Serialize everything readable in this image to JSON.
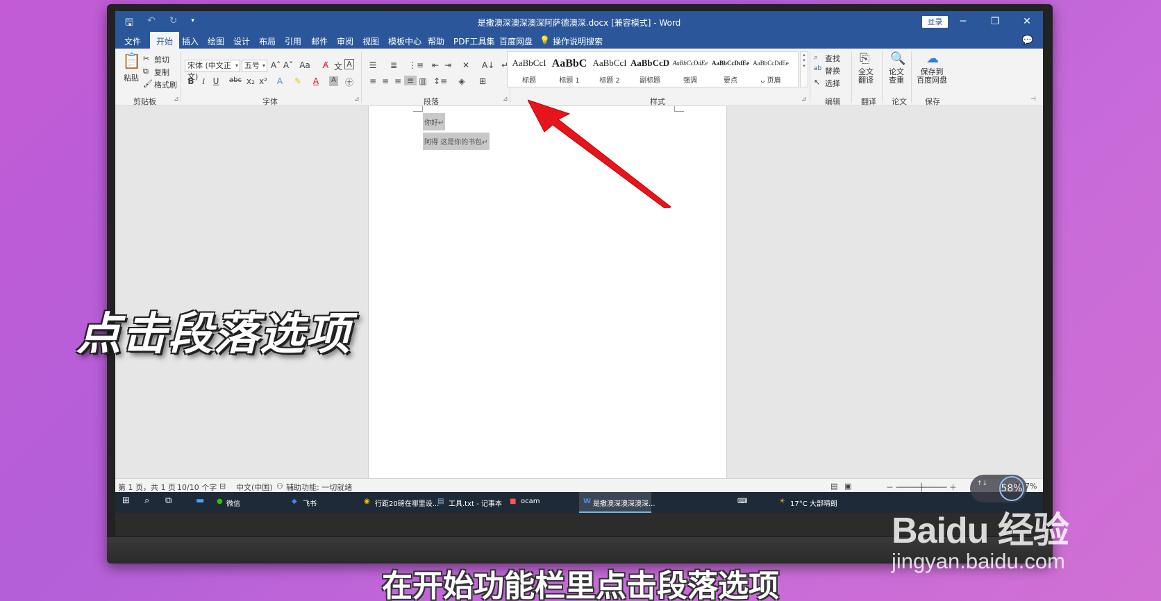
{
  "window": {
    "title": "是撒澳深澳深澳深阿萨德澳深.docx [兼容模式] - Word",
    "login_label": "登录",
    "controls": [
      "⊡",
      "─",
      "❐",
      "✕"
    ]
  },
  "quick_access": {
    "save_icon": "save-icon",
    "undo_icon": "undo-icon",
    "redo_icon": "redo-icon",
    "customize_icon": "customize-icon"
  },
  "menu_tabs": [
    "文件",
    "开始",
    "插入",
    "绘图",
    "设计",
    "布局",
    "引用",
    "邮件",
    "审阅",
    "视图",
    "模板中心",
    "帮助",
    "PDF工具集",
    "百度网盘"
  ],
  "active_tab": "开始",
  "tell_me": "操作说明搜索",
  "ribbon": {
    "clipboard": {
      "paste": "粘贴",
      "cut": "剪切",
      "copy": "复制",
      "format_painter": "格式刷",
      "label": "剪贴板"
    },
    "font": {
      "font_name": "宋体 (中文正文)",
      "font_size": "五号",
      "label": "字体",
      "bold": "B",
      "italic": "I",
      "underline": "U",
      "strike": "abc",
      "subscript": "x₂",
      "superscript": "x²"
    },
    "paragraph": {
      "label": "段落"
    },
    "styles": {
      "label": "样式",
      "items": [
        {
          "sample": "AaBbCcI",
          "name": "标题"
        },
        {
          "sample": "AaBbC",
          "name": "标题 1"
        },
        {
          "sample": "AaBbCcI",
          "name": "标题 2"
        },
        {
          "sample": "AaBbCcD",
          "name": "副标题"
        },
        {
          "sample": "AaBbCcDdEe",
          "name": "强调"
        },
        {
          "sample": "AaBbCcDdEe",
          "name": "要点"
        },
        {
          "sample": "AaBbCcDdEe",
          "name": "ᴗ 页眉"
        }
      ]
    },
    "editing": {
      "find": "查找",
      "replace": "替换",
      "select": "选择",
      "label": "编辑"
    },
    "translate": {
      "button": "全文\n翻译",
      "label": "翻译"
    },
    "paper": {
      "button": "论文\n查重",
      "label": "论文"
    },
    "save": {
      "button": "保存到\n百度网盘",
      "label": "保存"
    }
  },
  "document": {
    "lines": [
      "你好↵",
      "阿得 这是你的书包↵"
    ]
  },
  "statusbar": {
    "page": "第 1 页，共 1 页",
    "words": "10/10 个字",
    "language": "中文(中国)",
    "accessibility": "辅助功能: 一切就绪",
    "zoom": "107%"
  },
  "taskbar": {
    "items": [
      "微信",
      "飞书",
      "行距20磅在哪里设...",
      "工具.txt - 记事本",
      "ocam",
      "是撒澳深澳深澳深..."
    ],
    "weather": "17°C  大部晴朗"
  },
  "overlay": {
    "caption": "点击段落选项",
    "subtitle": "在开始功能栏里点击段落选项",
    "watermark_logo": "Baidu 经验",
    "watermark_url": "jingyan.baidu.com",
    "perf_percent": "58%"
  },
  "colors": {
    "word_blue": "#2b579a",
    "arrow_red": "#e8141b"
  }
}
